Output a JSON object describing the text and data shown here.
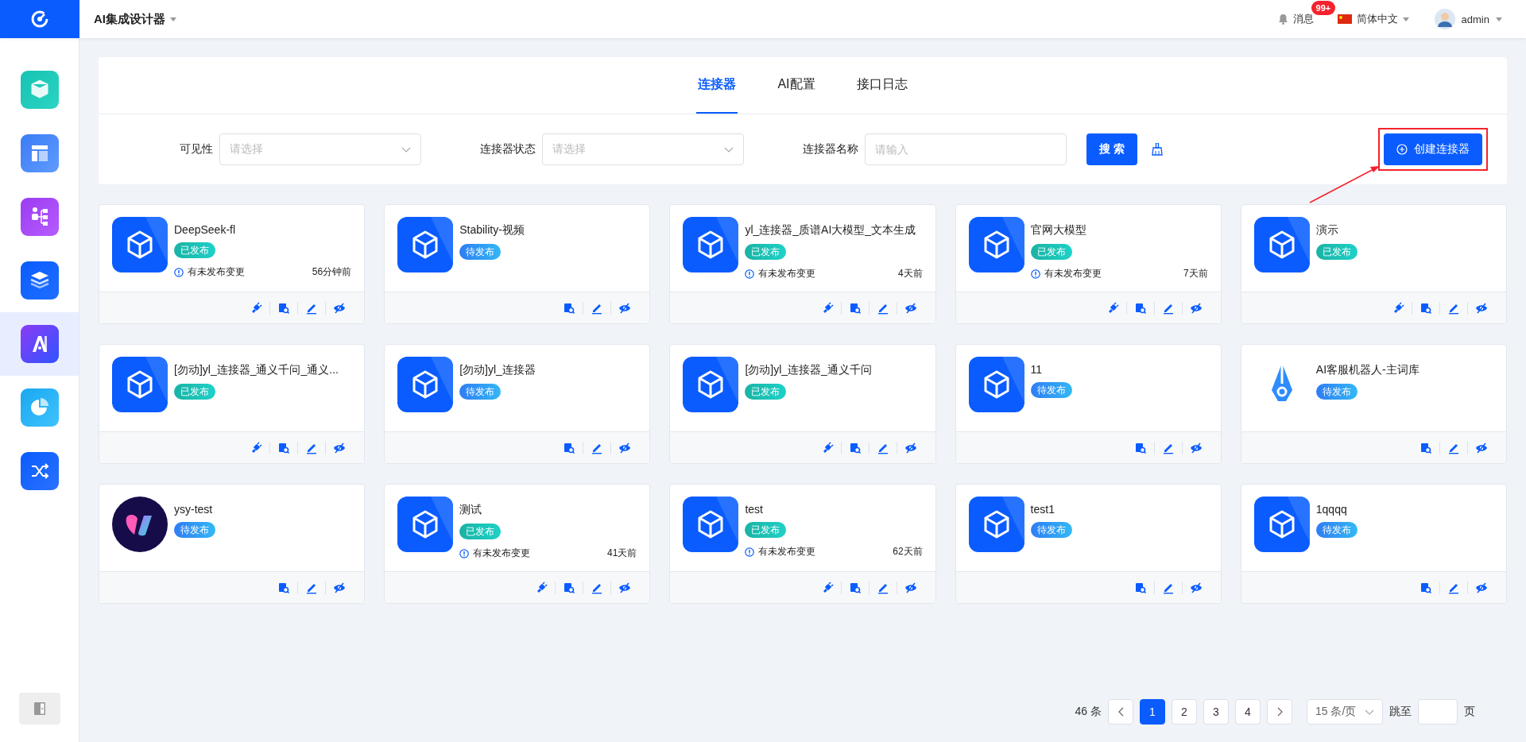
{
  "header": {
    "app_title": "AI集成设计器",
    "messages": {
      "label": "消息",
      "badge": "99+"
    },
    "language": "简体中文",
    "user": "admin"
  },
  "sidebar": {
    "items": [
      {
        "kind": "cube",
        "selected": false
      },
      {
        "kind": "layout",
        "selected": false
      },
      {
        "kind": "flow",
        "selected": false
      },
      {
        "kind": "layers",
        "selected": false
      },
      {
        "kind": "ai",
        "selected": true
      },
      {
        "kind": "pie",
        "selected": false
      },
      {
        "kind": "shuffle",
        "selected": false
      }
    ]
  },
  "tabs": [
    {
      "label": "连接器",
      "selected": true
    },
    {
      "label": "AI配置",
      "selected": false
    },
    {
      "label": "接口日志",
      "selected": false
    }
  ],
  "filters": [
    {
      "kind": "select",
      "label": "可见性",
      "placeholder": "请选择"
    },
    {
      "kind": "select",
      "label": "连接器状态",
      "placeholder": "请选择"
    },
    {
      "kind": "input",
      "label": "连接器名称",
      "placeholder": "请输入"
    }
  ],
  "search_button": "搜 索",
  "create_button": {
    "label": "创建连接器",
    "highlighted": true
  },
  "cards": [
    {
      "logo": {
        "kind": "cube"
      },
      "title": "DeepSeek-fl",
      "status": {
        "kind": "published",
        "text": "已发布"
      },
      "changes": "有未发布变更",
      "time": "56分钟前",
      "actions": [
        {
          "kind": "plug"
        },
        {
          "kind": "inspect"
        },
        {
          "kind": "edit"
        },
        {
          "kind": "hide"
        }
      ]
    },
    {
      "logo": {
        "kind": "cube"
      },
      "title": "Stability-视频",
      "status": {
        "kind": "pending",
        "text": "待发布"
      },
      "actions": [
        {
          "kind": "inspect"
        },
        {
          "kind": "edit"
        },
        {
          "kind": "hide"
        }
      ]
    },
    {
      "logo": {
        "kind": "cube"
      },
      "title": "yl_连接器_质谱AI大模型_文本生成",
      "status": {
        "kind": "published",
        "text": "已发布"
      },
      "changes": "有未发布变更",
      "time": "4天前",
      "actions": [
        {
          "kind": "plug"
        },
        {
          "kind": "inspect"
        },
        {
          "kind": "edit"
        },
        {
          "kind": "hide"
        }
      ]
    },
    {
      "logo": {
        "kind": "cube"
      },
      "title": "官网大模型",
      "status": {
        "kind": "published",
        "text": "已发布"
      },
      "changes": "有未发布变更",
      "time": "7天前",
      "actions": [
        {
          "kind": "plug"
        },
        {
          "kind": "inspect"
        },
        {
          "kind": "edit"
        },
        {
          "kind": "hide"
        }
      ]
    },
    {
      "logo": {
        "kind": "cube"
      },
      "title": "演示",
      "status": {
        "kind": "published",
        "text": "已发布"
      },
      "actions": [
        {
          "kind": "plug"
        },
        {
          "kind": "inspect"
        },
        {
          "kind": "edit"
        },
        {
          "kind": "hide"
        }
      ]
    },
    {
      "logo": {
        "kind": "cube"
      },
      "title": "[勿动]yl_连接器_通义千问_通义...",
      "status": {
        "kind": "published",
        "text": "已发布"
      },
      "actions": [
        {
          "kind": "plug"
        },
        {
          "kind": "inspect"
        },
        {
          "kind": "edit"
        },
        {
          "kind": "hide"
        }
      ]
    },
    {
      "logo": {
        "kind": "cube"
      },
      "title": "[勿动]yl_连接器",
      "status": {
        "kind": "pending",
        "text": "待发布"
      },
      "actions": [
        {
          "kind": "inspect"
        },
        {
          "kind": "edit"
        },
        {
          "kind": "hide"
        }
      ]
    },
    {
      "logo": {
        "kind": "cube"
      },
      "title": "[勿动]yl_连接器_通义千问",
      "status": {
        "kind": "published",
        "text": "已发布"
      },
      "actions": [
        {
          "kind": "plug"
        },
        {
          "kind": "inspect"
        },
        {
          "kind": "edit"
        },
        {
          "kind": "hide"
        }
      ]
    },
    {
      "logo": {
        "kind": "cube"
      },
      "title": "11",
      "status": {
        "kind": "pending",
        "text": "待发布"
      },
      "actions": [
        {
          "kind": "inspect"
        },
        {
          "kind": "edit"
        },
        {
          "kind": "hide"
        }
      ]
    },
    {
      "logo": {
        "kind": "pen"
      },
      "title": "AI客服机器人-主词库",
      "status": {
        "kind": "pending",
        "text": "待发布"
      },
      "actions": [
        {
          "kind": "inspect"
        },
        {
          "kind": "edit"
        },
        {
          "kind": "hide"
        }
      ]
    },
    {
      "logo": {
        "kind": "mark"
      },
      "title": "ysy-test",
      "status": {
        "kind": "pending",
        "text": "待发布"
      },
      "actions": [
        {
          "kind": "inspect"
        },
        {
          "kind": "edit"
        },
        {
          "kind": "hide"
        }
      ]
    },
    {
      "logo": {
        "kind": "cube"
      },
      "title": "测试",
      "status": {
        "kind": "published",
        "text": "已发布"
      },
      "changes": "有未发布变更",
      "time": "41天前",
      "actions": [
        {
          "kind": "plug"
        },
        {
          "kind": "inspect"
        },
        {
          "kind": "edit"
        },
        {
          "kind": "hide"
        }
      ]
    },
    {
      "logo": {
        "kind": "cube"
      },
      "title": "test",
      "status": {
        "kind": "published",
        "text": "已发布"
      },
      "changes": "有未发布变更",
      "time": "62天前",
      "actions": [
        {
          "kind": "plug"
        },
        {
          "kind": "inspect"
        },
        {
          "kind": "edit"
        },
        {
          "kind": "hide"
        }
      ]
    },
    {
      "logo": {
        "kind": "cube"
      },
      "title": "test1",
      "status": {
        "kind": "pending",
        "text": "待发布"
      },
      "actions": [
        {
          "kind": "inspect"
        },
        {
          "kind": "edit"
        },
        {
          "kind": "hide"
        }
      ]
    },
    {
      "logo": {
        "kind": "cube"
      },
      "title": "1qqqq",
      "status": {
        "kind": "pending",
        "text": "待发布"
      },
      "actions": [
        {
          "kind": "inspect"
        },
        {
          "kind": "edit"
        },
        {
          "kind": "hide"
        }
      ]
    }
  ],
  "pagination": {
    "total": "46 条",
    "pages": [
      {
        "label": "1",
        "selected": true
      },
      {
        "label": "2",
        "selected": false
      },
      {
        "label": "3",
        "selected": false
      },
      {
        "label": "4",
        "selected": false
      }
    ],
    "page_size": "15 条/页",
    "jump_label": "跳至",
    "page_suffix": "页"
  }
}
